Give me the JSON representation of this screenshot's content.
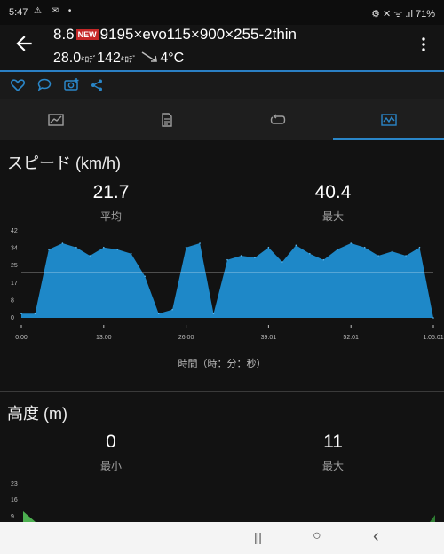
{
  "status_bar": {
    "time": "5:47",
    "notification_icons": "⚠ ✉ •",
    "right_text": "⚙ ✕ ᯤ .ıl 71%"
  },
  "header": {
    "title_line1_prefix": "8.6",
    "new_badge": "NEW",
    "title_line1_rest": "9195×evo115×900×255-2thin",
    "title_line2_a": "28.0",
    "title_line2_unit_a": "ｷﾛﾃﾞ",
    "title_line2_b": "142",
    "title_line2_unit_b": "ｷﾛﾃﾞ",
    "title_line2_c": "4°C"
  },
  "icons": {
    "back": "back-arrow-icon",
    "menu": "more-vert-icon",
    "like": "heart-icon",
    "comment": "comment-icon",
    "photo": "add-photo-icon",
    "share": "share-icon"
  },
  "colors": {
    "accent": "#2a86c8",
    "chart_fill": "#1e88c8",
    "elevation_fill": "#4caf50"
  },
  "speed": {
    "section_title": "スピード (km/h)",
    "avg_value": "21.7",
    "avg_label": "平均",
    "max_value": "40.4",
    "max_label": "最大",
    "x_axis_title": "時間（時：分：秒）"
  },
  "elevation": {
    "section_title": "高度 (m)",
    "min_value": "0",
    "min_label": "最小",
    "max_value": "11",
    "max_label": "最大"
  },
  "chart_data": [
    {
      "type": "area",
      "title": "",
      "xlabel": "時間（時：分：秒）",
      "ylabel": "",
      "x_ticks": [
        "0:00",
        "13:00",
        "26:00",
        "39:01",
        "52:01",
        "1:05:01"
      ],
      "y_ticks": [
        "0",
        "8",
        "17",
        "25",
        "34",
        "42"
      ],
      "ylim": [
        0,
        42
      ],
      "reference_line": 21.7,
      "x": [
        "0:00",
        "2:10",
        "4:20",
        "6:30",
        "8:40",
        "10:50",
        "13:00",
        "15:10",
        "17:20",
        "19:30",
        "21:40",
        "23:50",
        "26:00",
        "28:10",
        "30:20",
        "32:30",
        "34:40",
        "36:50",
        "39:01",
        "41:11",
        "43:21",
        "45:31",
        "47:41",
        "49:51",
        "52:01",
        "54:11",
        "56:21",
        "58:31",
        "1:00:41",
        "1:02:51",
        "1:05:01"
      ],
      "values": [
        2,
        2,
        33,
        36,
        34,
        30,
        34,
        33,
        31,
        20,
        2,
        4,
        34,
        36,
        2,
        28,
        30,
        29,
        34,
        27,
        35,
        31,
        28,
        33,
        36,
        34,
        30,
        32,
        30,
        34,
        0
      ]
    },
    {
      "type": "area",
      "title": "",
      "xlabel": "",
      "ylabel": "",
      "y_ticks": [
        "9",
        "16",
        "23"
      ],
      "values": [
        2,
        0
      ]
    }
  ],
  "navbar": {
    "recent": "|||",
    "home": "○",
    "back": "‹"
  }
}
